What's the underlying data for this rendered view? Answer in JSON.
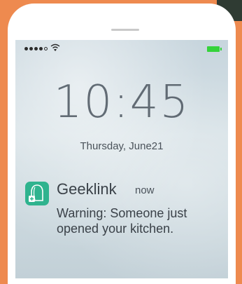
{
  "status_bar": {
    "signal_dots_filled": 4,
    "signal_dots_total": 5,
    "battery_color": "#35d33b"
  },
  "lock_screen": {
    "time": "10:45",
    "date": "Thursday, June21"
  },
  "notification": {
    "icon": "geeklink-app-icon",
    "icon_color": "#2fb38e",
    "app_name": "Geeklink",
    "time": "now",
    "message": "Warning: Someone just opened your kitchen."
  }
}
